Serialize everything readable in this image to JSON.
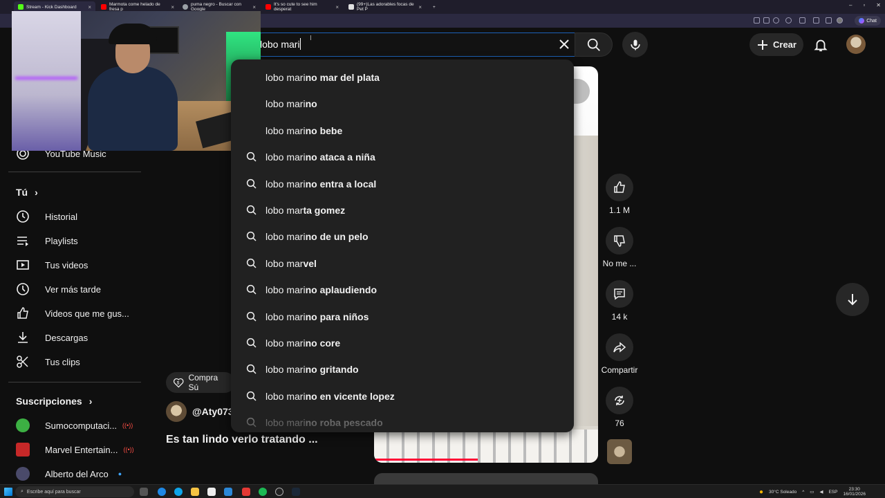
{
  "browser": {
    "tabs": [
      {
        "title": "Stream - Kick Dashboard",
        "color": "#53fc18"
      },
      {
        "title": "Marmota come helado de fresa p",
        "color": "#ff0000"
      },
      {
        "title": "puma negro - Buscar con Google",
        "color": "#9aa0a6"
      },
      {
        "title": "It's so cute to see him desperat",
        "color": "#ff0000"
      },
      {
        "title": "(99+)Las adorables focas de Pet P",
        "color": "#e0e0e0"
      }
    ],
    "new_tab": "+",
    "chat_label": "Chat",
    "window_controls": [
      "–",
      "▫",
      "✕"
    ]
  },
  "header": {
    "search_value": "lobo mari",
    "create_label": "Crear"
  },
  "search_suggestions": [
    {
      "prefix": "lobo mari",
      "rest": "no mar del plata"
    },
    {
      "prefix": "lobo mari",
      "rest": "no"
    },
    {
      "prefix": "lobo mari",
      "rest": "no bebe"
    },
    {
      "prefix": "lobo mari",
      "rest": "no ataca a niña"
    },
    {
      "prefix": "lobo mari",
      "rest": "no entra a local"
    },
    {
      "prefix": "lobo mar",
      "rest": "ta gomez"
    },
    {
      "prefix": "lobo mari",
      "rest": "no de un pelo"
    },
    {
      "prefix": "lobo mar",
      "rest": "vel"
    },
    {
      "prefix": "lobo mari",
      "rest": "no aplaudiendo"
    },
    {
      "prefix": "lobo mari",
      "rest": "no para niños"
    },
    {
      "prefix": "lobo mari",
      "rest": "no core"
    },
    {
      "prefix": "lobo mari",
      "rest": "no gritando"
    },
    {
      "prefix": "lobo mari",
      "rest": "no en vicente lopez"
    },
    {
      "prefix": "lobo mari",
      "rest": "no roba pescado"
    }
  ],
  "sidebar": {
    "youtube_music": "YouTube Music",
    "you_heading": "Tú",
    "you_items": [
      {
        "label": "Historial",
        "icon": "history-icon"
      },
      {
        "label": "Playlists",
        "icon": "playlists-icon"
      },
      {
        "label": "Tus videos",
        "icon": "your-videos-icon"
      },
      {
        "label": "Ver más tarde",
        "icon": "watch-later-icon"
      },
      {
        "label": "Videos que me gus...",
        "icon": "liked-videos-icon"
      },
      {
        "label": "Descargas",
        "icon": "downloads-icon"
      },
      {
        "label": "Tus clips",
        "icon": "clips-icon"
      }
    ],
    "subs_heading": "Suscripciones",
    "subscriptions": [
      {
        "label": "Sumocomputaci...",
        "live": true,
        "color": "#3cb043"
      },
      {
        "label": "Marvel Entertain...",
        "live": true,
        "color": "#c62828"
      },
      {
        "label": "Alberto del Arco",
        "live": false,
        "color": "#4a4a6a"
      }
    ]
  },
  "short": {
    "buy_chip": "Compra Sú",
    "channel": "@Aty073",
    "title": "Es tan lindo verlo tratando ...",
    "likes": "1.1 M",
    "dislike_label": "No me ...",
    "comments": "14 k",
    "share_label": "Compartir",
    "remix_count": "76"
  },
  "taskbar": {
    "search_placeholder": "Escribe aquí para buscar",
    "weather": "30°C  Soleado",
    "lang": "ESP",
    "time": "23:30",
    "date": "16/01/2026"
  }
}
